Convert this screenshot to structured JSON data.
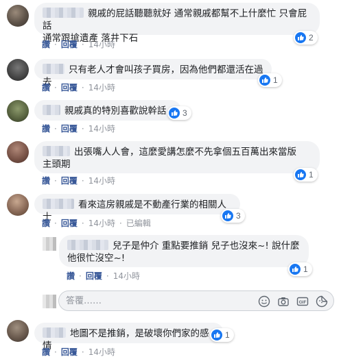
{
  "actions": {
    "like": "讚",
    "reply": "回覆",
    "sep": "·",
    "edited": "已編輯"
  },
  "comments": [
    {
      "line1": "親戚的屁話聽聽就好 通常親戚都幫不上什麼忙 只會屁話",
      "line2": "通常跟搶遺產 落井下石",
      "reactions": "2",
      "time": "14小時"
    },
    {
      "line1": "只有老人才會叫孩子買房，因為他們都還活在過去",
      "reactions": "1",
      "time": "14小時"
    },
    {
      "line1": "親戚真的特別喜歡說幹話",
      "reactions": "3",
      "time": "14小時"
    },
    {
      "line1": "出張嘴人人會，這麼愛講怎麼不先拿個五百萬出來當版",
      "line2": "主頭期",
      "reactions": "1",
      "time": "14小時"
    },
    {
      "line1": "看來這房親戚是不動產行業的相關人士",
      "reactions": "3",
      "time": "14小時"
    },
    {
      "line1": "兒子是仲介 重點要推銷 兒子也沒來~! 說什麼",
      "line2": "他很忙沒空~!",
      "reactions": "1",
      "time": "14小時"
    },
    {
      "line1": "地圖不是推銷，是破壞你們家的感情",
      "reactions": "1",
      "time": "14小時"
    }
  ],
  "reply_box": {
    "placeholder": "答覆……"
  },
  "icons": [
    "like-icon",
    "emoji-icon",
    "camera-icon",
    "gif-icon",
    "sticker-icon"
  ],
  "colors": {
    "like_blue": "#1877f2",
    "link_blue": "#385898",
    "bubble_bg": "#f2f3f5",
    "meta_gray": "#90949c"
  }
}
